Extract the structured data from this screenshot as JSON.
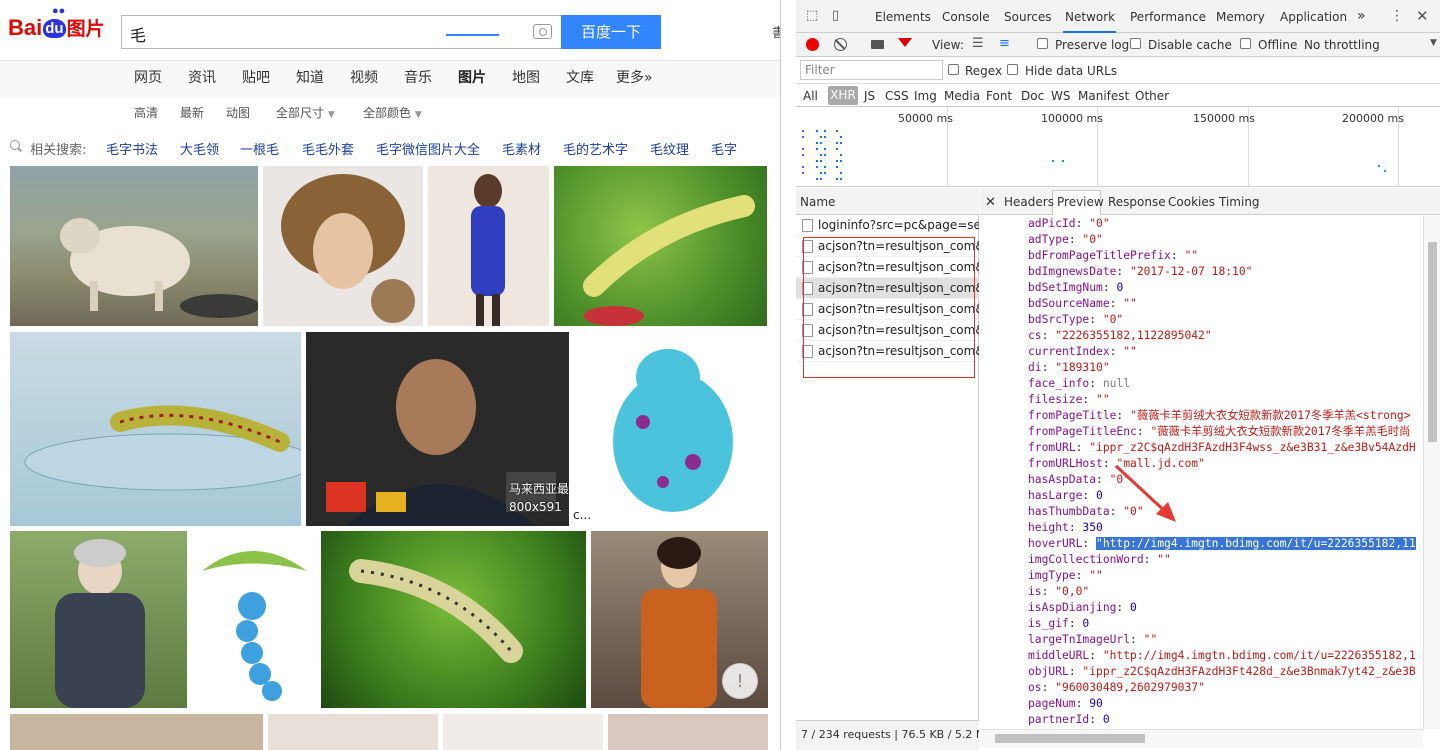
{
  "baidu": {
    "logo": {
      "bai": "Bai",
      "du": "du",
      "pic": "图片"
    },
    "search": {
      "value": "毛",
      "button": "百度一下"
    },
    "edge_char": "書",
    "nav": [
      "网页",
      "资讯",
      "贴吧",
      "知道",
      "视频",
      "音乐",
      "图片",
      "地图",
      "文库",
      "更多»"
    ],
    "filters": [
      "高清",
      "最新",
      "动图",
      "全部尺寸",
      "全部颜色"
    ],
    "related_label": "相关搜索:",
    "related": [
      "毛字书法",
      "大毛领",
      "一根毛",
      "毛毛外套",
      "毛字微信图片大全",
      "毛素材",
      "毛的艺术字",
      "毛纹理",
      "毛字"
    ],
    "image_caption": {
      "title": "马来西亚最",
      "size": "800x591"
    },
    "image_caption2": "c..."
  },
  "devtools": {
    "tabs": [
      "Elements",
      "Console",
      "Sources",
      "Network",
      "Performance",
      "Memory",
      "Application",
      "»"
    ],
    "toolbar": {
      "view": "View:",
      "preserve_log": "Preserve log",
      "disable_cache": "Disable cache",
      "offline": "Offline",
      "throttling": "No throttling"
    },
    "filter": {
      "placeholder": "Filter",
      "regex": "Regex",
      "hide_data_urls": "Hide data URLs"
    },
    "types": [
      "All",
      "XHR",
      "JS",
      "CSS",
      "Img",
      "Media",
      "Font",
      "Doc",
      "WS",
      "Manifest",
      "Other"
    ],
    "overview_labels": [
      "50000 ms",
      "100000 ms",
      "150000 ms",
      "200000 ms"
    ],
    "name_header": "Name",
    "requests": [
      "logininfo?src=pc&page=se...",
      "acjson?tn=resultjson_com&...",
      "acjson?tn=resultjson_com&...",
      "acjson?tn=resultjson_com&...",
      "acjson?tn=resultjson_com&...",
      "acjson?tn=resultjson_com&...",
      "acjson?tn=resultjson_com&..."
    ],
    "detail_tabs": [
      "Headers",
      "Preview",
      "Response",
      "Cookies",
      "Timing"
    ],
    "status": {
      "requests": "7 / 234 requests",
      "size": "76.5 KB / 5.2 M..."
    },
    "json_lines": [
      {
        "k": "adPicId",
        "v": "\"0\"",
        "t": "s"
      },
      {
        "k": "adType",
        "v": "\"0\"",
        "t": "s"
      },
      {
        "k": "bdFromPageTitlePrefix",
        "v": "\"\"",
        "t": "s"
      },
      {
        "k": "bdImgnewsDate",
        "v": "\"2017-12-07 18:10\"",
        "t": "s"
      },
      {
        "k": "bdSetImgNum",
        "v": "0",
        "t": "n"
      },
      {
        "k": "bdSourceName",
        "v": "\"\"",
        "t": "s"
      },
      {
        "k": "bdSrcType",
        "v": "\"0\"",
        "t": "s"
      },
      {
        "k": "cs",
        "v": "\"2226355182,1122895042\"",
        "t": "s"
      },
      {
        "k": "currentIndex",
        "v": "\"\"",
        "t": "s"
      },
      {
        "k": "di",
        "v": "\"189310\"",
        "t": "s"
      },
      {
        "k": "face_info",
        "v": "null",
        "t": "null"
      },
      {
        "k": "filesize",
        "v": "\"\"",
        "t": "s"
      },
      {
        "k": "fromPageTitle",
        "v": "\"薇薇卡羊剪绒大衣女短款新款2017冬季羊羔<strong>",
        "t": "s"
      },
      {
        "k": "fromPageTitleEnc",
        "v": "\"薇薇卡羊剪绒大衣女短款新款2017冬季羊羔毛时尚",
        "t": "s"
      },
      {
        "k": "fromURL",
        "v": "\"ippr_z2C$qAzdH3FAzdH3F4wss_z&e3B31_z&e3Bv54AzdH",
        "t": "s"
      },
      {
        "k": "fromURLHost",
        "v": "\"mall.jd.com\"",
        "t": "s"
      },
      {
        "k": "hasAspData",
        "v": "\"0\"",
        "t": "s"
      },
      {
        "k": "hasLarge",
        "v": "0",
        "t": "n"
      },
      {
        "k": "hasThumbData",
        "v": "\"0\"",
        "t": "s"
      },
      {
        "k": "height",
        "v": "350",
        "t": "n"
      },
      {
        "k": "hoverURL",
        "v": "\"http://img4.imgtn.bdimg.com/it/u=2226355182,11",
        "t": "hl"
      },
      {
        "k": "imgCollectionWord",
        "v": "\"\"",
        "t": "s"
      },
      {
        "k": "imgType",
        "v": "\"\"",
        "t": "s"
      },
      {
        "k": "is",
        "v": "\"0,0\"",
        "t": "s"
      },
      {
        "k": "isAspDianjing",
        "v": "0",
        "t": "n"
      },
      {
        "k": "is_gif",
        "v": "0",
        "t": "n"
      },
      {
        "k": "largeTnImageUrl",
        "v": "\"\"",
        "t": "s"
      },
      {
        "k": "middleURL",
        "v": "\"http://img4.imgtn.bdimg.com/it/u=2226355182,1",
        "t": "s"
      },
      {
        "k": "objURL",
        "v": "\"ippr_z2C$qAzdH3FAzdH3Ft428d_z&e3Bnmak7yt42_z&e3B",
        "t": "s"
      },
      {
        "k": "os",
        "v": "\"960030489,2602979037\"",
        "t": "s"
      },
      {
        "k": "pageNum",
        "v": "90",
        "t": "n"
      },
      {
        "k": "partnerId",
        "v": "0",
        "t": "n"
      }
    ]
  },
  "colors": {
    "baidu_blue": "#3385ff",
    "baidu_red": "#e10601",
    "devtools_accent": "#1a73e8",
    "annotation_red": "#e53935"
  }
}
